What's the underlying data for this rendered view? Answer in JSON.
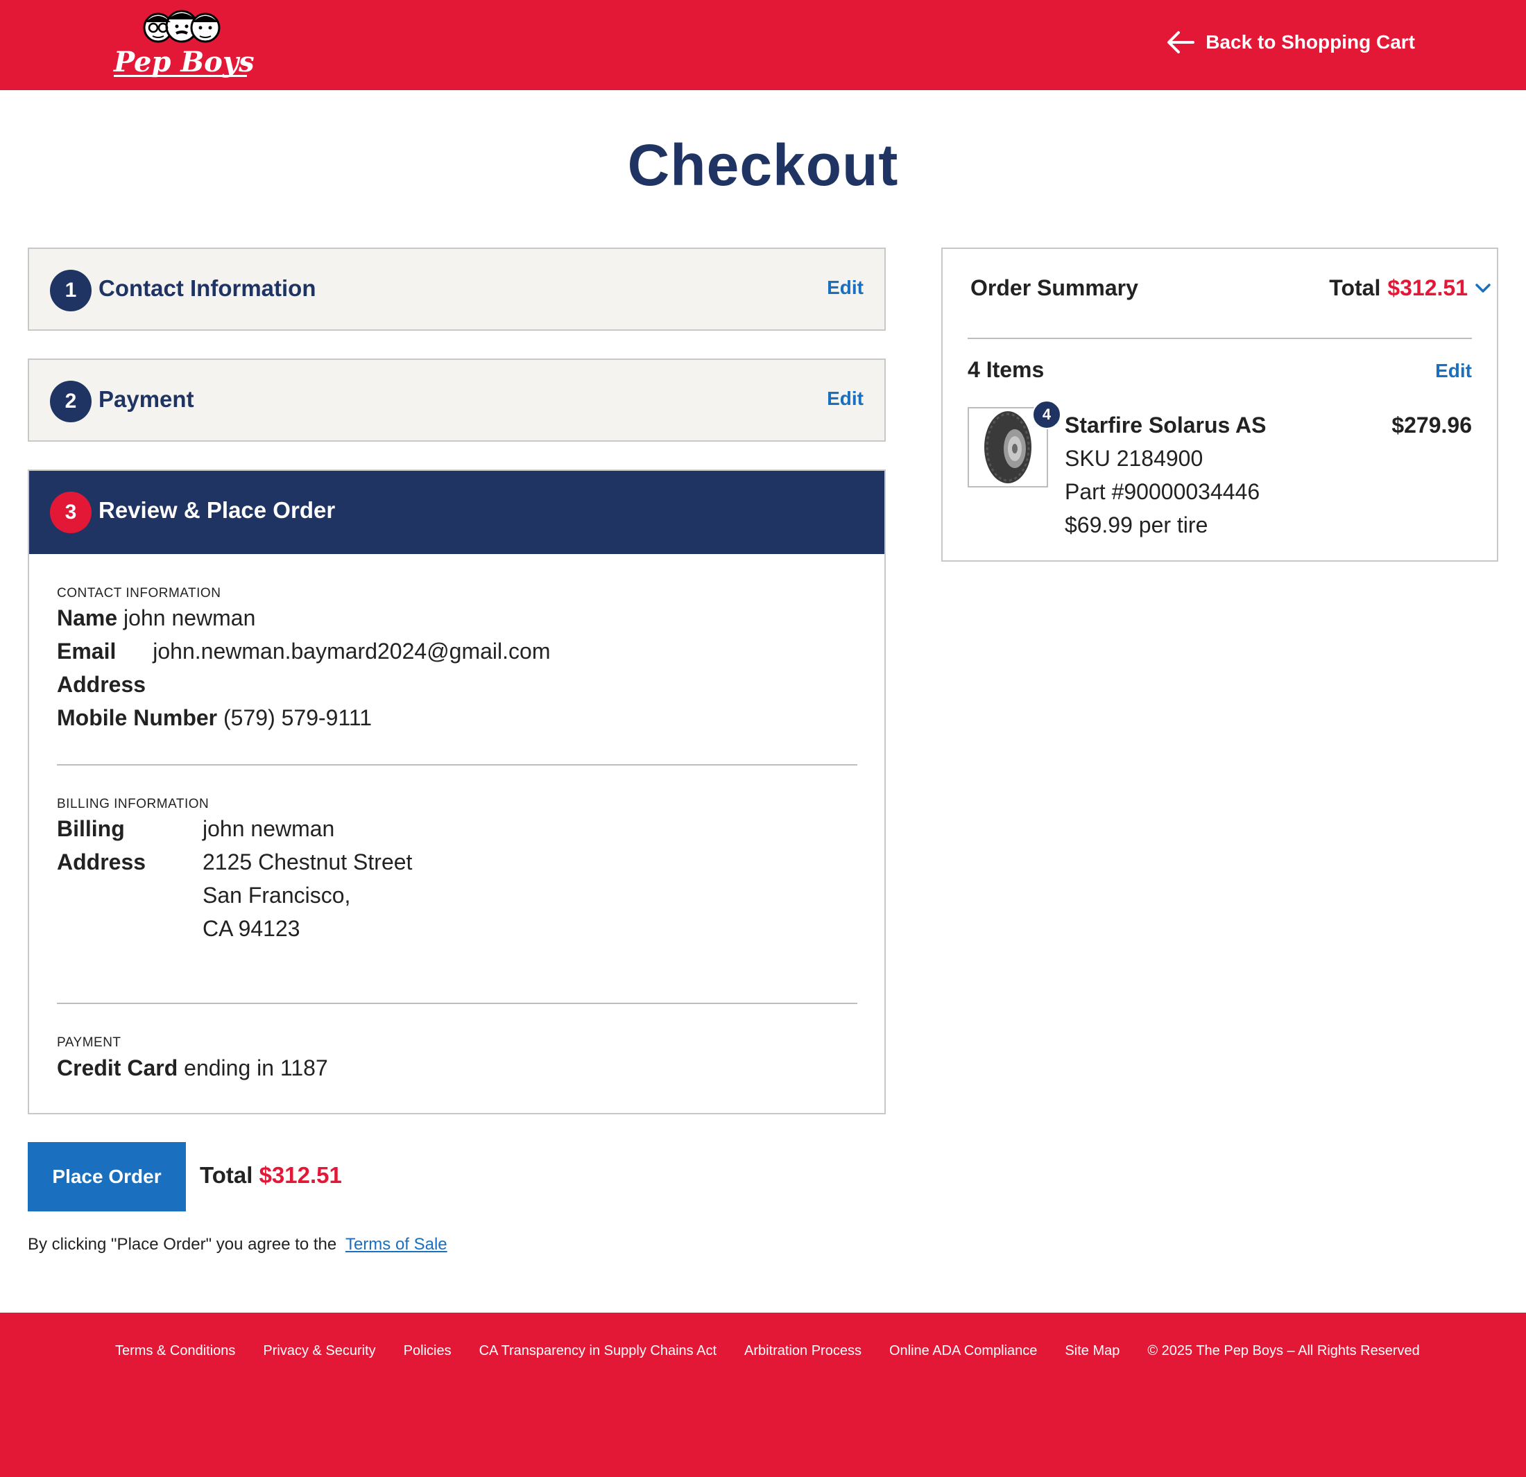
{
  "header": {
    "brand": "Pep Boys",
    "back_label": "Back to Shopping Cart"
  },
  "page_title": "Checkout",
  "steps": [
    {
      "number": "1",
      "label": "Contact Information",
      "edit": "Edit"
    },
    {
      "number": "2",
      "label": "Payment",
      "edit": "Edit"
    },
    {
      "number": "3",
      "label": "Review & Place Order"
    }
  ],
  "review": {
    "contact": {
      "caption": "Contact Information",
      "name_label": "Name",
      "name": "john newman",
      "email_label": "Email",
      "email": "john.newman.baymard2024@gmail.com",
      "address_label": "Address",
      "mobile_label": "Mobile Number",
      "mobile": "(579) 579-9111"
    },
    "billing": {
      "caption": "Billing Information",
      "label_1": "Billing",
      "label_2": "Address",
      "lines": [
        "john newman",
        "2125 Chestnut Street",
        "San Francisco,",
        "CA 94123"
      ]
    },
    "payment": {
      "caption": "Payment",
      "method_label": "Credit Card",
      "method_detail": "ending in 1187"
    }
  },
  "place_order": {
    "button_label": "Place Order",
    "total_label": "Total",
    "total_value": "$312.51",
    "agree_text": "By clicking \"Place Order\" you agree to the",
    "terms_link": "Terms of Sale"
  },
  "summary": {
    "title": "Order Summary",
    "total_label": "Total",
    "total_value": "$312.51",
    "items_label": "4 Items",
    "edit": "Edit",
    "item": {
      "quantity": "4",
      "name": "Starfire Solarus AS",
      "price": "$279.96",
      "sku": "SKU 2184900",
      "part": "Part #90000034446",
      "unit_price": "$69.99 per tire"
    }
  },
  "footer": {
    "links": [
      "Terms & Conditions",
      "Privacy & Security",
      "Policies",
      "CA Transparency in Supply Chains Act",
      "Arbitration Process",
      "Online ADA Compliance",
      "Site Map",
      "© 2025 The Pep Boys – All Rights Reserved"
    ]
  },
  "colors": {
    "brand_red": "#e31837",
    "navy": "#1f3463",
    "link_blue": "#1a6fbf"
  }
}
